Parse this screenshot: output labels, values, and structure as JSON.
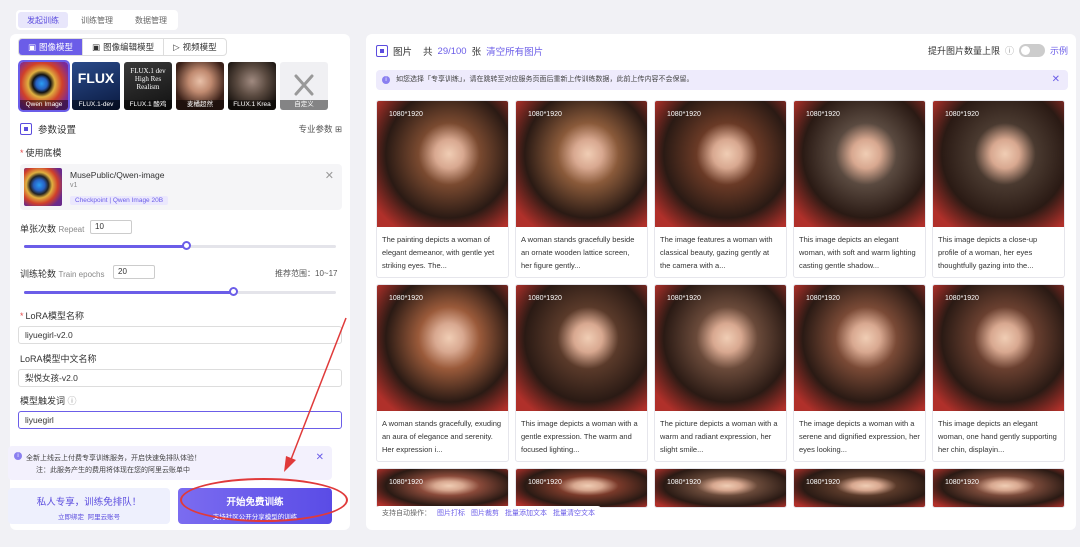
{
  "top_tabs": [
    {
      "label": "发起训练",
      "active": true
    },
    {
      "label": "训练管理",
      "active": false
    },
    {
      "label": "数据管理",
      "active": false
    }
  ],
  "mode_tabs": [
    {
      "label": "图像模型",
      "icon": "image-icon",
      "active": true
    },
    {
      "label": "图像编辑模型",
      "icon": "image-edit-icon",
      "active": false
    },
    {
      "label": "视频模型",
      "icon": "video-icon",
      "active": false
    }
  ],
  "models": [
    {
      "label": "Qwen Image",
      "selected": true
    },
    {
      "label": "FLUX.1-dev",
      "big": "FLUX",
      "selected": false
    },
    {
      "label": "FLUX.1 酸鸡",
      "big": "FLUX.1 dev\nHigh Res\nRealism",
      "selected": false
    },
    {
      "label": "麦橘超然",
      "selected": false
    },
    {
      "label": "FLUX.1 Krea",
      "selected": false
    },
    {
      "label": "自定义",
      "selected": false
    }
  ],
  "params": {
    "title": "参数设置",
    "pro_label": "专业参数",
    "base_label": "使用底模",
    "base": {
      "name": "MusePublic/Qwen-image",
      "version": "v1",
      "tag": "Checkpoint | Qwen Image 20B"
    },
    "repeat_label": "单张次数",
    "repeat_sub": "Repeat",
    "repeat_value": "10",
    "repeat_fraction": 0.52,
    "epoch_label": "训练轮数",
    "epoch_sub": "Train epochs",
    "epoch_value": "20",
    "epoch_fraction": 0.67,
    "epoch_range": "推荐范围：10~17",
    "lora_name_label": "LoRA模型名称",
    "lora_name_value": "liyuegirl-v2.0",
    "lora_cn_label": "LoRA模型中文名称",
    "lora_cn_value": "梨悦女孩-v2.0",
    "trigger_label": "模型触发词",
    "trigger_value": "liyuegirl"
  },
  "notice": {
    "line1": "全新上线云上付费专享训练服务，开启快速免排队体验！",
    "line2": "注：此服务产生的费用将体现在您的阿里云账单中"
  },
  "btn_private": {
    "title": "私人专享，训练免排队！",
    "sub_a": "立即绑定",
    "sub_b": "阿里云账号"
  },
  "btn_start": {
    "title": "开始免费训练",
    "sub": "支持社区公开分享模型的训练"
  },
  "right": {
    "title": "图片",
    "count_prefix": "共",
    "count": "29/100",
    "count_suffix": "张",
    "clear": "清空所有图片",
    "upgrade": "提升图片数量上限",
    "example": "示例",
    "note": "如您选择「专享训练」，请在跳转至对应服务页面后重新上传训练数据，此前上传内容不会保留。"
  },
  "images": [
    {
      "res": "1080*1920",
      "desc": "The painting depicts a woman of elegant demeanor, with gentle yet striking eyes. The...",
      "bg": "#7a4a30"
    },
    {
      "res": "1080*1920",
      "desc": "A woman stands gracefully beside an ornate wooden lattice screen, her figure gently...",
      "bg": "#8a5a3a"
    },
    {
      "res": "1080*1920",
      "desc": "The image features a woman with classical beauty, gazing gently at the camera with a...",
      "bg": "#6a3a26"
    },
    {
      "res": "1080*1920",
      "desc": "This image depicts an elegant woman, with soft and warm lighting casting gentle shadow...",
      "bg": "#5a4a40"
    },
    {
      "res": "1080*1920",
      "desc": "This image depicts a close-up profile of a woman, her eyes thoughtfully gazing into the...",
      "bg": "#4a3a30"
    },
    {
      "res": "1080*1920",
      "desc": "A woman stands gracefully, exuding an aura of elegance and serenity. Her expression i...",
      "bg": "#9a5a3a"
    },
    {
      "res": "1080*1920",
      "desc": "This image depicts a woman with a gentle expression. The warm and focused lighting...",
      "bg": "#5a3a2a"
    },
    {
      "res": "1080*1920",
      "desc": "The picture depicts a woman with a warm and radiant expression, her slight smile...",
      "bg": "#6a4a3a"
    },
    {
      "res": "1080*1920",
      "desc": "The image depicts a woman with a serene and dignified expression, her eyes looking...",
      "bg": "#7a4a36"
    },
    {
      "res": "1080*1920",
      "desc": "This image depicts an elegant woman, one hand gently supporting her chin, displayin...",
      "bg": "#6a4030"
    },
    {
      "res": "1080*1920",
      "desc": "",
      "bg": "#8a4a3a"
    },
    {
      "res": "1080*1920",
      "desc": "",
      "bg": "#7a3a2a"
    },
    {
      "res": "1080*1920",
      "desc": "",
      "bg": "#6a4a3a"
    },
    {
      "res": "1080*1920",
      "desc": "",
      "bg": "#5a3a2a"
    },
    {
      "res": "1080*1920",
      "desc": "",
      "bg": "#7a4a3a"
    }
  ],
  "bottom_ops": {
    "label": "支持自动操作：",
    "items": [
      "图片打标",
      "图片裁剪",
      "批量添加文本",
      "批量清空文本"
    ]
  },
  "colors": {
    "accent": "#6b5de8",
    "annotation": "#e03a3a"
  }
}
